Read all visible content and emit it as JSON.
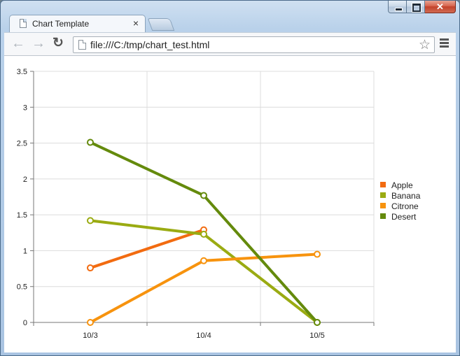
{
  "window": {
    "caption_buttons": [
      "minimize",
      "maximize",
      "close"
    ]
  },
  "tabs": [
    {
      "title": "Chart Template",
      "icon": "page-icon",
      "active": true
    }
  ],
  "toolbar": {
    "url": "file:///C:/tmp/chart_test.html",
    "back_icon": "back-arrow-icon",
    "forward_icon": "forward-arrow-icon",
    "reload_icon": "reload-icon",
    "star_icon": "star-icon",
    "menu_icon": "menu-icon"
  },
  "chart_data": {
    "type": "line",
    "categories": [
      "10/3",
      "10/4",
      "10/5"
    ],
    "y_ticks": [
      "0",
      "0.5",
      "1",
      "1.5",
      "2",
      "2.5",
      "3",
      "3.5"
    ],
    "ylim": [
      0,
      3.5
    ],
    "grid": true,
    "legend_position": "right",
    "series": [
      {
        "name": "Apple",
        "color": "#f26b10",
        "values": [
          0.76,
          1.29,
          null
        ]
      },
      {
        "name": "Banana",
        "color": "#9aab12",
        "values": [
          1.42,
          1.23,
          0.0
        ]
      },
      {
        "name": "Citrone",
        "color": "#f7930e",
        "values": [
          0.0,
          0.86,
          0.95
        ]
      },
      {
        "name": "Desert",
        "color": "#648a0c",
        "values": [
          2.51,
          1.77,
          0.0
        ]
      }
    ]
  }
}
